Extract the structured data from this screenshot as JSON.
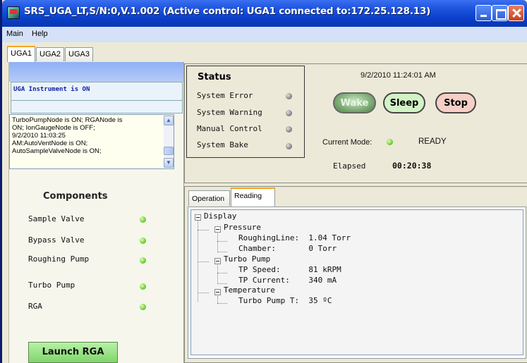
{
  "window": {
    "title": "SRS_UGA_LT,S/N:0,V.1.002  (Active control: UGA1 connected to:172.25.128.13)"
  },
  "menu": {
    "main": "Main",
    "help": "Help"
  },
  "tabs": [
    "UGA1",
    "UGA2",
    "UGA3"
  ],
  "left": {
    "uga_status": "UGA Instrument is ON",
    "log_lines": [
      "TurboPumpNode is ON; RGANode is",
      "ON; IonGaugeNode is OFF;",
      "9/2/2010 11:03:25",
      "AM:AutoVentNode is ON;",
      "AutoSampleValveNode is ON;"
    ],
    "components_title": "Components",
    "components": [
      {
        "label": "Sample Valve",
        "state": "green"
      },
      {
        "label": "Bypass Valve",
        "state": "green"
      },
      {
        "label": "Roughing Pump",
        "state": "green"
      },
      {
        "label": "Turbo Pump",
        "state": "green"
      },
      {
        "label": "RGA",
        "state": "green"
      }
    ],
    "launch_label": "Launch RGA"
  },
  "status": {
    "title": "Status",
    "rows": [
      {
        "label": "System Error",
        "state": "grey"
      },
      {
        "label": "System Warning",
        "state": "grey"
      },
      {
        "label": "Manual Control",
        "state": "grey"
      },
      {
        "label": "System Bake",
        "state": "grey"
      }
    ]
  },
  "control": {
    "datetime": "9/2/2010 11:24:01 AM",
    "wake_label": "Wake",
    "sleep_label": "Sleep",
    "stop_label": "Stop",
    "current_mode_label": "Current Mode:",
    "current_mode_value": "READY",
    "elapsed_label": "Elapsed",
    "elapsed_value": "00:20:38"
  },
  "inner_tabs": {
    "operation": "Operation",
    "reading": "Reading"
  },
  "tree": {
    "display": "Display",
    "pressure": "Pressure",
    "roughing_line": "RoughingLine:  1.04 Torr",
    "chamber": "Chamber:       0 Torr",
    "turbo_pump": "Turbo Pump",
    "tp_speed": "TP Speed:      81 kRPM",
    "tp_current": "TP Current:    340 mA",
    "temperature": "Temperature",
    "turbo_pump_t": "Turbo Pump T:  35 ºC"
  },
  "colors": {
    "titlebar": "#0a3fc8",
    "led_on": "#6fd03a",
    "led_off": "#888888",
    "launch_button": "#7fd66a",
    "stop_button": "#f6cfc6",
    "sleep_button": "#d2f3c6"
  }
}
